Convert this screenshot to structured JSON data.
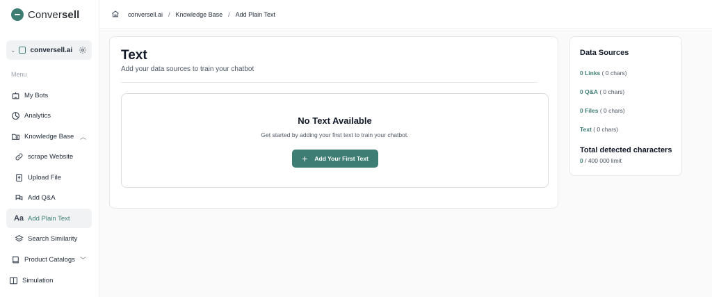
{
  "brand": {
    "name_regular": "Conver",
    "name_bold": "sell"
  },
  "workspace": {
    "name": "conversell.ai"
  },
  "sidebar": {
    "menu_label": "Menu",
    "items": [
      {
        "label": "My Bots",
        "icon": "bot-icon"
      },
      {
        "label": "Analytics",
        "icon": "analytics-icon"
      },
      {
        "label": "Knowledge Base",
        "icon": "knowledge-base-icon",
        "expanded": true
      },
      {
        "label": "scrape Website",
        "icon": "link-icon"
      },
      {
        "label": "Upload File",
        "icon": "upload-file-icon"
      },
      {
        "label": "Add Q&A",
        "icon": "qa-icon"
      },
      {
        "label": "Add Plain Text",
        "icon": "text-icon",
        "active": true
      },
      {
        "label": "Search Similarity",
        "icon": "layers-icon"
      },
      {
        "label": "Product Catalogs",
        "icon": "book-icon",
        "expanded": false
      },
      {
        "label": "Simulation",
        "icon": "columns-icon"
      }
    ]
  },
  "breadcrumb": {
    "items": [
      "conversell.ai",
      "Knowledge Base",
      "Add Plain Text"
    ],
    "separator": "/"
  },
  "main": {
    "title": "Text",
    "subtitle": "Add your data sources to train your chatbot",
    "empty_title": "No Text Available",
    "empty_description": "Get started by adding your first text to train your chatbot.",
    "add_button_icon": "+",
    "add_button_label": "Add Your First Text"
  },
  "data_sources": {
    "title": "Data Sources",
    "links_value": "0 Links",
    "links_chars": " ( 0 chars)",
    "qa_value": "0 Q&A",
    "qa_chars": " ( 0 chars)",
    "files_value": "0 Files",
    "files_chars": " ( 0 chars)",
    "text_value": "Text",
    "text_chars": " ( 0 chars)",
    "total_title": "Total detected characters",
    "total_value": "0",
    "total_limit": " / 400 000 limit"
  },
  "colors": {
    "accent": "#3e7d74",
    "active_bg": "#f1f2f3"
  }
}
